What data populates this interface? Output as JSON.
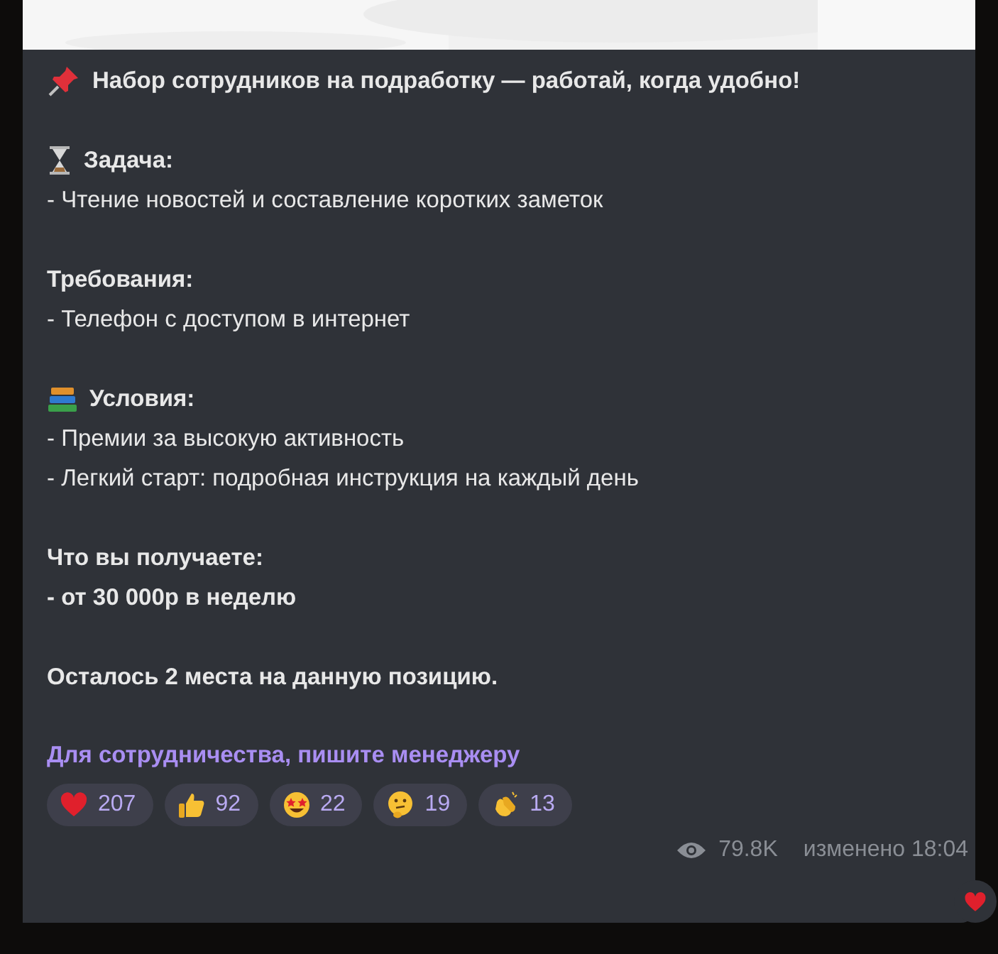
{
  "message": {
    "title": "Набор сотрудников на подработку — работай, когда удобно!",
    "sections": [
      {
        "heading": "Задача:",
        "lines": [
          {
            "text": "- Чтение новостей и составление коротких заметок",
            "bold": false
          }
        ]
      },
      {
        "heading": "Требования:",
        "lines": [
          {
            "text": "- Телефон с доступом в интернет",
            "bold": false
          }
        ]
      },
      {
        "heading": "Условия:",
        "lines": [
          {
            "text": "- Премии за высокую активность",
            "bold": false
          },
          {
            "text": "- Легкий старт: подробная инструкция на каждый день",
            "bold": false
          }
        ]
      },
      {
        "heading": "Что вы получаете:",
        "lines": [
          {
            "text": "- от 30 000р в неделю",
            "bold": true
          }
        ]
      },
      {
        "heading": "Осталось 2 места на данную позицию."
      }
    ],
    "link": "Для сотрудничества, пишите менеджеру",
    "reactions": [
      {
        "count": "207"
      },
      {
        "count": "92"
      },
      {
        "count": "22"
      },
      {
        "count": "19"
      },
      {
        "count": "13"
      }
    ],
    "views": "79.8K",
    "edited": "изменено 18:04"
  }
}
